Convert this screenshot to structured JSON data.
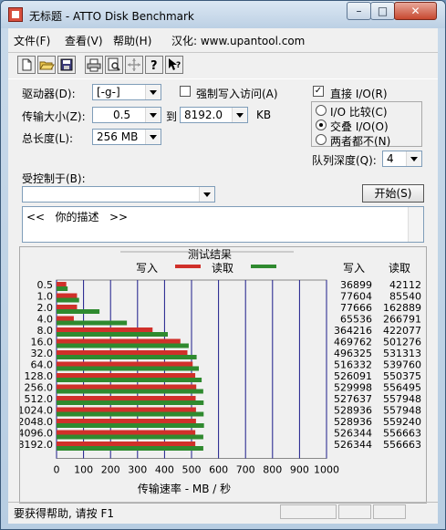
{
  "window": {
    "title": "无标题 - ATTO Disk Benchmark",
    "min": "–",
    "max": "□",
    "close": "✕"
  },
  "menu": {
    "file": "文件(F)",
    "view": "查看(V)",
    "help": "帮助(H)",
    "hanhua": "汉化: www.upantool.com"
  },
  "toolbar": [
    "new-icon",
    "open-icon",
    "save-icon",
    "print-icon",
    "print-preview-icon",
    "move-icon",
    "help-icon",
    "context-help-icon"
  ],
  "form": {
    "drive_label": "驱动器(D):",
    "drive_value": "[-g-]",
    "transfer_label": "传输大小(Z):",
    "transfer_from": "0.5",
    "to_label": "到",
    "transfer_to": "8192.0",
    "kb": "KB",
    "length_label": "总长度(L):",
    "length_value": "256 MB",
    "force_write_label": "强制写入访问(A)",
    "direct_io_label": "直接 I/O(R)",
    "io_compare_label": "I/O 比较(C)",
    "overlapped_io_label": "交叠 I/O(O)",
    "neither_label": "两者都不(N)",
    "queue_label": "队列深度(Q):",
    "queue_value": "4",
    "controlled_label": "受控制于(B):",
    "start_button": "开始(S)",
    "description": "<<   你的描述   >>"
  },
  "status_text": "要获得帮助, 请按 F1",
  "chart_data": {
    "type": "bar",
    "title": "测试结果",
    "legend_write": "写入",
    "legend_read": "读取",
    "col_write": "写入",
    "col_read": "读取",
    "xlabel": "传输速率 - MB / 秒",
    "xlim": [
      0,
      1000
    ],
    "xticks": [
      0,
      100,
      200,
      300,
      400,
      500,
      600,
      700,
      800,
      900,
      1000
    ],
    "colors": {
      "write": "#d0302a",
      "read": "#2f8a2f"
    },
    "categories": [
      "0.5",
      "1.0",
      "2.0",
      "4.0",
      "8.0",
      "16.0",
      "32.0",
      "64.0",
      "128.0",
      "256.0",
      "512.0",
      "1024.0",
      "2048.0",
      "4096.0",
      "8192.0"
    ],
    "series": [
      {
        "name": "写入",
        "values": [
          36899,
          77604,
          77666,
          65536,
          364216,
          469762,
          496325,
          516332,
          526091,
          529998,
          527637,
          528936,
          528936,
          526344,
          526344
        ]
      },
      {
        "name": "读取",
        "values": [
          42112,
          85540,
          162889,
          266791,
          422077,
          501276,
          531313,
          539760,
          550375,
          556495,
          557948,
          557948,
          559240,
          556663,
          556663
        ]
      }
    ]
  }
}
